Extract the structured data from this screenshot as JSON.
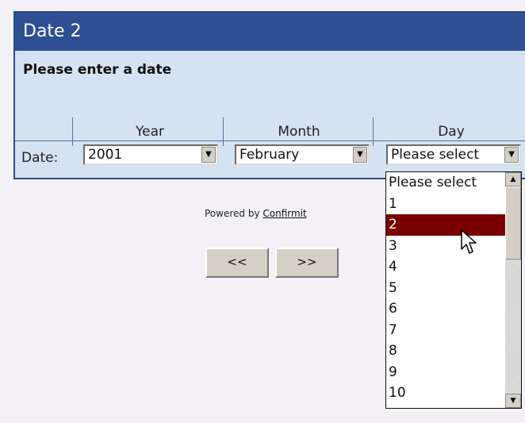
{
  "question": {
    "title": "Date 2",
    "prompt": "Please enter a date"
  },
  "columns": [
    "Year",
    "Month",
    "Day"
  ],
  "row_label": "Date:",
  "selects": {
    "year": {
      "value": "2001"
    },
    "month": {
      "value": "February"
    },
    "day": {
      "value": "Please select"
    }
  },
  "day_options": [
    "Please select",
    "1",
    "2",
    "3",
    "4",
    "5",
    "6",
    "7",
    "8",
    "9",
    "10"
  ],
  "day_highlighted": "2",
  "footer": {
    "powered_prefix": "Powered by",
    "powered_link": "Confirmit"
  },
  "nav": {
    "back": "<<",
    "next": ">>"
  },
  "colors": {
    "title_bar": "#2e4f93",
    "panel": "#d5e2f2",
    "highlight": "#7a0000"
  }
}
